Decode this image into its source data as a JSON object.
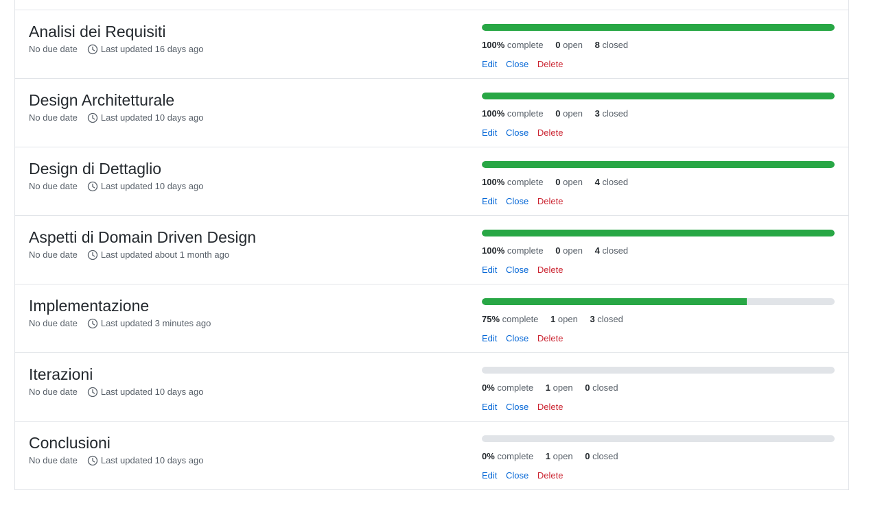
{
  "labels": {
    "complete_suffix": "complete",
    "open_suffix": "open",
    "closed_suffix": "closed",
    "edit": "Edit",
    "close": "Close",
    "delete": "Delete"
  },
  "colors": {
    "progress_fill": "#28a745",
    "progress_track": "#e1e4e8",
    "link": "#0366d6",
    "danger": "#cb2431"
  },
  "icons": {
    "updated": "clock-icon"
  },
  "milestones": [
    {
      "title": "Analisi dei Requisiti",
      "due": "No due date",
      "updated": "Last updated 16 days ago",
      "percent_label": "100%",
      "percent": 100,
      "open": "0",
      "closed": "8"
    },
    {
      "title": "Design Architetturale",
      "due": "No due date",
      "updated": "Last updated 10 days ago",
      "percent_label": "100%",
      "percent": 100,
      "open": "0",
      "closed": "3"
    },
    {
      "title": "Design di Dettaglio",
      "due": "No due date",
      "updated": "Last updated 10 days ago",
      "percent_label": "100%",
      "percent": 100,
      "open": "0",
      "closed": "4"
    },
    {
      "title": "Aspetti di Domain Driven Design",
      "due": "No due date",
      "updated": "Last updated about 1 month ago",
      "percent_label": "100%",
      "percent": 100,
      "open": "0",
      "closed": "4"
    },
    {
      "title": "Implementazione",
      "due": "No due date",
      "updated": "Last updated 3 minutes ago",
      "percent_label": "75%",
      "percent": 75,
      "open": "1",
      "closed": "3"
    },
    {
      "title": "Iterazioni",
      "due": "No due date",
      "updated": "Last updated 10 days ago",
      "percent_label": "0%",
      "percent": 0,
      "open": "1",
      "closed": "0"
    },
    {
      "title": "Conclusioni",
      "due": "No due date",
      "updated": "Last updated 10 days ago",
      "percent_label": "0%",
      "percent": 0,
      "open": "1",
      "closed": "0"
    }
  ]
}
